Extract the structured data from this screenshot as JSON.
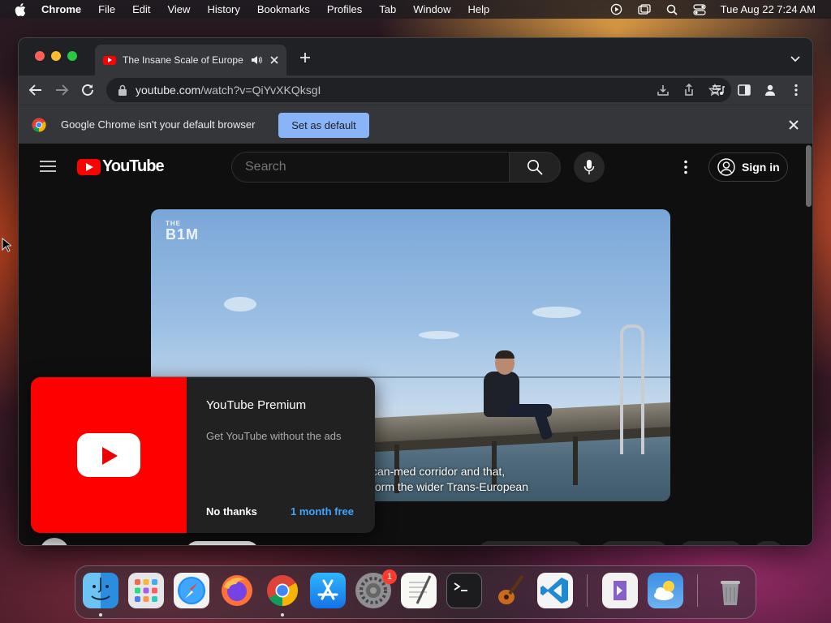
{
  "menubar": {
    "app": "Chrome",
    "items": [
      "File",
      "Edit",
      "View",
      "History",
      "Bookmarks",
      "Profiles",
      "Tab",
      "Window",
      "Help"
    ],
    "clock": "Tue Aug 22  7:24 AM",
    "status_icons": [
      "play-circle-icon",
      "screen-mirror-icon",
      "search-icon",
      "control-center-icon"
    ]
  },
  "browser": {
    "tab_title": "The Insane Scale of Europe",
    "url_host": "youtube.com",
    "url_path": "/watch?v=QiYvXKQksgI",
    "infobar_message": "Google Chrome isn't your default browser",
    "infobar_button": "Set as default"
  },
  "youtube": {
    "logo_text": "YouTube",
    "search_placeholder": "Search",
    "sign_in": "Sign in",
    "video_brand_small": "THE",
    "video_brand_big": "B1M",
    "caption_line1": "can-med corridor and that,",
    "caption_line2": "form the wider Trans-European"
  },
  "premium_popup": {
    "title": "YouTube Premium",
    "subtitle": "Get YouTube without the ads",
    "dismiss": "No thanks",
    "cta": "1 month free"
  },
  "dock": {
    "apps": [
      "Finder",
      "Launchpad",
      "Safari",
      "Firefox",
      "Google Chrome",
      "App Store",
      "System Settings",
      "TextEdit",
      "Terminal",
      "GarageBand",
      "Visual Studio Code",
      "Visual Studio",
      "Weather",
      "Trash"
    ],
    "settings_badge": "1"
  },
  "colors": {
    "youtube_red": "#ff0000",
    "link_blue": "#3ea6ff",
    "infobar_button": "#8ab4f8"
  }
}
